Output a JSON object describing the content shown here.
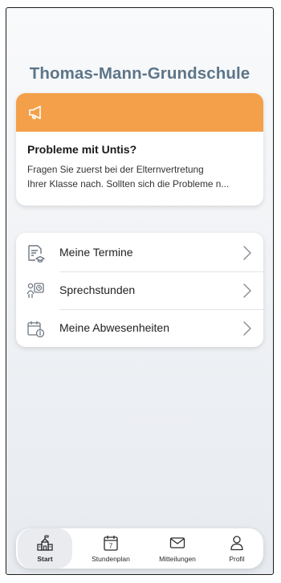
{
  "header": {
    "school_name": "Thomas-Mann-Grundschule"
  },
  "notice": {
    "icon": "megaphone-icon",
    "accent_color": "#f4a04a",
    "title": "Probleme mit Untis?",
    "text": "Fragen Sie zuerst bei der Elternvertretung\nIhrer Klasse nach. Sollten sich die Probleme n..."
  },
  "menu": {
    "items": [
      {
        "label": "Meine Termine",
        "icon": "appointments-icon"
      },
      {
        "label": "Sprechstunden",
        "icon": "office-hours-icon"
      },
      {
        "label": "Meine Abwesenheiten",
        "icon": "absences-icon"
      }
    ]
  },
  "tabs": [
    {
      "label": "Start",
      "icon": "school-icon",
      "active": true
    },
    {
      "label": "Stundenplan",
      "icon": "calendar-icon",
      "day": "7",
      "active": false
    },
    {
      "label": "Mitteilungen",
      "icon": "envelope-icon",
      "active": false
    },
    {
      "label": "Profil",
      "icon": "person-icon",
      "active": false
    }
  ]
}
